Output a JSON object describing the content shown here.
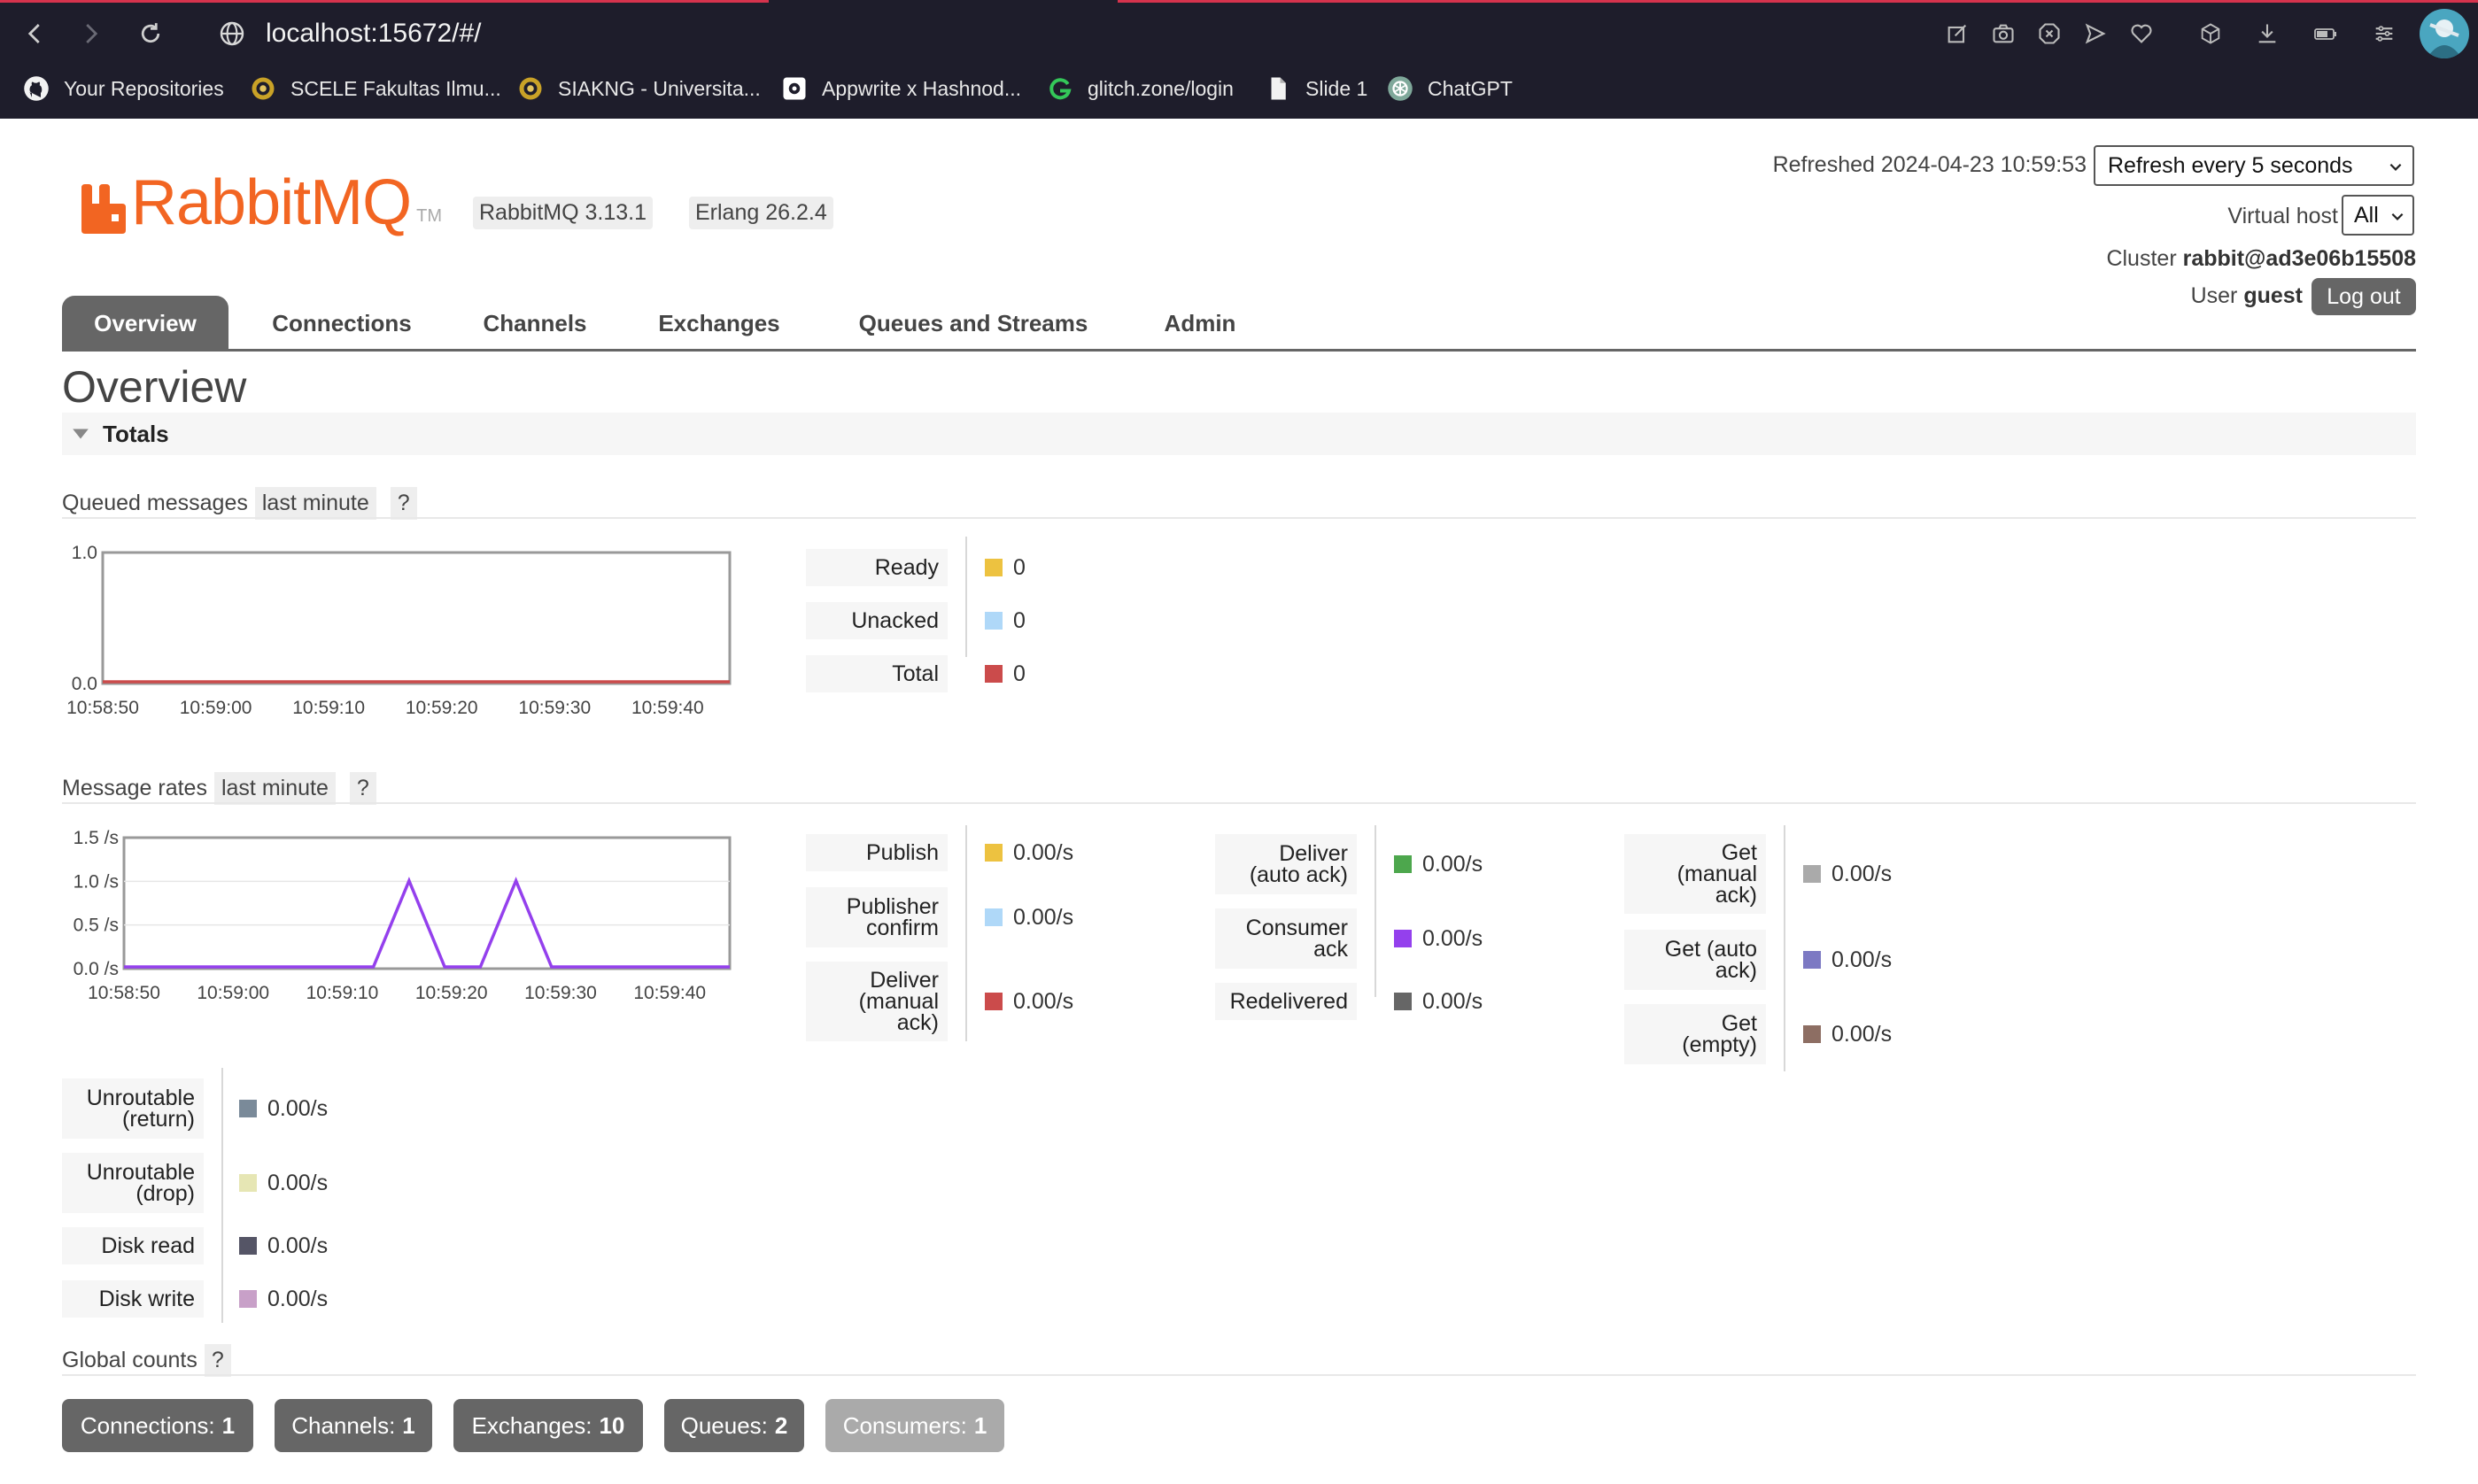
{
  "browser": {
    "url": "localhost:15672/#/",
    "bookmarks": [
      {
        "label": "Your Repositories",
        "icon": "github-icon"
      },
      {
        "label": "SCELE Fakultas Ilmu...",
        "icon": "scele-icon"
      },
      {
        "label": "SIAKNG - Universita...",
        "icon": "siakng-icon"
      },
      {
        "label": "Appwrite x Hashnod...",
        "icon": "hashnode-icon"
      },
      {
        "label": "glitch.zone/login",
        "icon": "glitch-icon"
      },
      {
        "label": "Slide 1",
        "icon": "document-icon"
      },
      {
        "label": "ChatGPT",
        "icon": "chatgpt-icon"
      }
    ]
  },
  "header": {
    "logo_text": "RabbitMQ",
    "logo_tm": "TM",
    "version_badge": "RabbitMQ 3.13.1",
    "erlang_badge": "Erlang 26.2.4",
    "refreshed_label": "Refreshed 2024-04-23 10:59:53",
    "refresh_select_value": "Refresh every 5 seconds",
    "vhost_label": "Virtual host",
    "vhost_value": "All",
    "cluster_label": "Cluster",
    "cluster_value": "rabbit@ad3e06b15508",
    "user_label": "User",
    "user_value": "guest",
    "logout_label": "Log out"
  },
  "tabs": [
    "Overview",
    "Connections",
    "Channels",
    "Exchanges",
    "Queues and Streams",
    "Admin"
  ],
  "page_title": "Overview",
  "totals_label": "Totals",
  "queued": {
    "title": "Queued messages",
    "range": "last minute",
    "help": "?",
    "stats": [
      {
        "label": "Ready",
        "value": "0",
        "color": "#edc240"
      },
      {
        "label": "Unacked",
        "value": "0",
        "color": "#afd8f8"
      },
      {
        "label": "Total",
        "value": "0",
        "color": "#cb4b4b"
      }
    ]
  },
  "rates": {
    "title": "Message rates",
    "range": "last minute",
    "help": "?",
    "col1": [
      {
        "label": [
          "Publish"
        ],
        "value": "0.00/s",
        "color": "#edc240"
      },
      {
        "label": [
          "Publisher",
          "confirm"
        ],
        "value": "0.00/s",
        "color": "#afd8f8"
      },
      {
        "label": [
          "Deliver",
          "(manual",
          "ack)"
        ],
        "value": "0.00/s",
        "color": "#cb4b4b"
      }
    ],
    "col2": [
      {
        "label": [
          "Deliver",
          "(auto ack)"
        ],
        "value": "0.00/s",
        "color": "#4da74d"
      },
      {
        "label": [
          "Consumer",
          "ack"
        ],
        "value": "0.00/s",
        "color": "#9440ed"
      },
      {
        "label": [
          "Redelivered"
        ],
        "value": "0.00/s",
        "color": "#666666"
      }
    ],
    "col3": [
      {
        "label": [
          "Get",
          "(manual",
          "ack)"
        ],
        "value": "0.00/s",
        "color": "#aaaaaa"
      },
      {
        "label": [
          "Get (auto",
          "ack)"
        ],
        "value": "0.00/s",
        "color": "#7c79c3"
      },
      {
        "label": [
          "Get",
          "(empty)"
        ],
        "value": "0.00/s",
        "color": "#8d6e63"
      }
    ],
    "col4": [
      {
        "label": [
          "Unroutable",
          "(return)"
        ],
        "value": "0.00/s",
        "color": "#7a8a99"
      },
      {
        "label": [
          "Unroutable",
          "(drop)"
        ],
        "value": "0.00/s",
        "color": "#e6e6b4"
      },
      {
        "label": [
          "Disk read"
        ],
        "value": "0.00/s",
        "color": "#555566"
      },
      {
        "label": [
          "Disk write"
        ],
        "value": "0.00/s",
        "color": "#c8a0c8"
      }
    ]
  },
  "global": {
    "title": "Global counts",
    "help": "?",
    "counts": [
      {
        "label": "Connections:",
        "value": "1"
      },
      {
        "label": "Channels:",
        "value": "1"
      },
      {
        "label": "Exchanges:",
        "value": "10"
      },
      {
        "label": "Queues:",
        "value": "2"
      },
      {
        "label": "Consumers:",
        "value": "1"
      }
    ]
  },
  "chart_data": [
    {
      "type": "line",
      "x": [
        "10:58:50",
        "10:59:00",
        "10:59:10",
        "10:59:20",
        "10:59:30",
        "10:59:40"
      ],
      "yticks": [
        "1.0",
        "0.0"
      ],
      "ylim": [
        0,
        1
      ],
      "series": [
        {
          "name": "Total",
          "color": "#cb4b4b",
          "values": [
            0,
            0,
            0,
            0,
            0,
            0,
            0,
            0,
            0,
            0,
            0,
            0,
            0
          ]
        }
      ]
    },
    {
      "type": "line",
      "x": [
        "10:58:50",
        "10:59:00",
        "10:59:10",
        "10:59:20",
        "10:59:30",
        "10:59:40"
      ],
      "yticks": [
        "1.5 /s",
        "1.0 /s",
        "0.5 /s",
        "0.0 /s"
      ],
      "ylim": [
        0,
        1.5
      ],
      "series": [
        {
          "name": "Consumer ack",
          "color": "#9440ed",
          "values": [
            0,
            0,
            0,
            0,
            0,
            0,
            0,
            0,
            1,
            0,
            0,
            1,
            0,
            0,
            0,
            0,
            0,
            0
          ]
        }
      ]
    }
  ]
}
